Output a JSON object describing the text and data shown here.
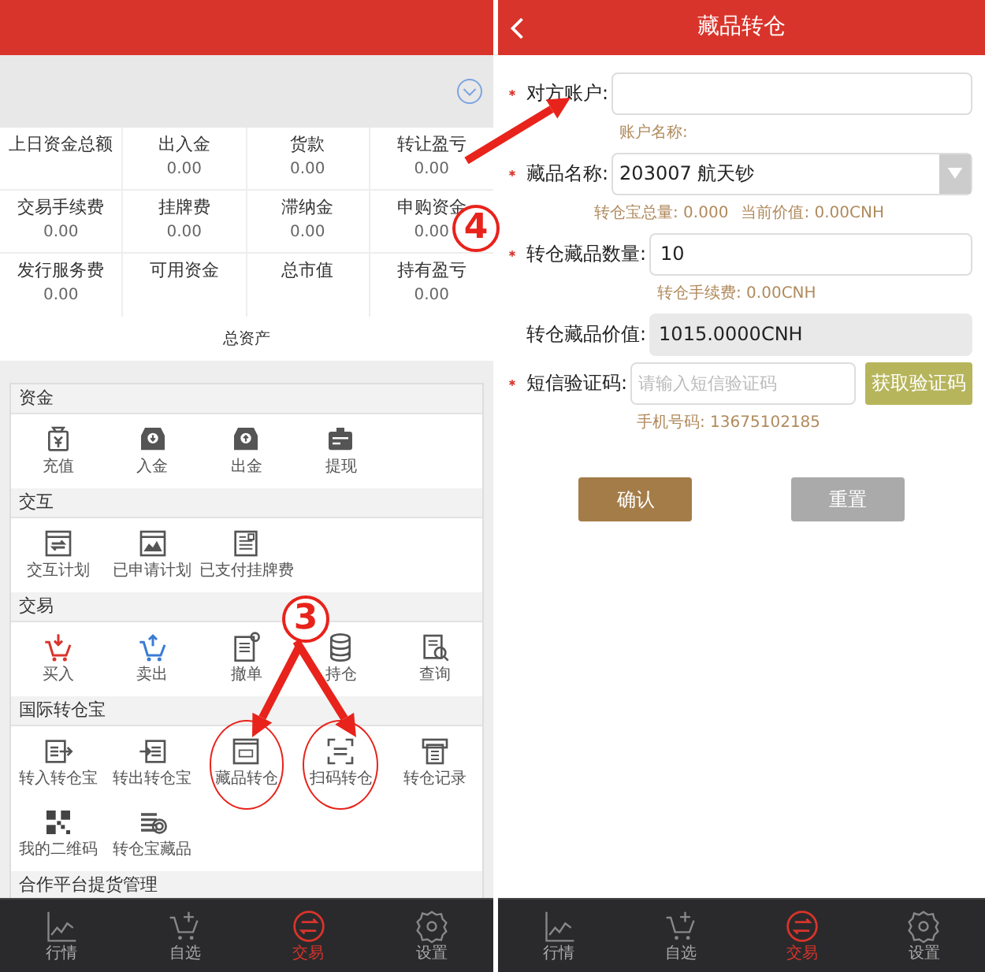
{
  "left_screen": {
    "summary": [
      {
        "label": "上日资金总额"
      },
      {
        "label": "出入金",
        "value": "0.00"
      },
      {
        "label": "货款",
        "value": "0.00"
      },
      {
        "label": "转让盈亏",
        "value": "0.00"
      },
      {
        "label": "交易手续费",
        "value": "0.00"
      },
      {
        "label": "挂牌费",
        "value": "0.00"
      },
      {
        "label": "滞纳金",
        "value": "0.00"
      },
      {
        "label": "申购资金",
        "value": "0.00"
      },
      {
        "label": "发行服务费",
        "value": "0.00"
      },
      {
        "label": "可用资金"
      },
      {
        "label": "总市值"
      },
      {
        "label": "持有盈亏",
        "value": "0.00"
      }
    ],
    "total_label": "总资产",
    "sections": [
      {
        "title": "资金",
        "items": [
          {
            "label": "充值",
            "circled": false
          },
          {
            "label": "入金",
            "circled": false
          },
          {
            "label": "出金",
            "circled": false
          },
          {
            "label": "提现",
            "circled": false
          }
        ]
      },
      {
        "title": "交互",
        "items": [
          {
            "label": "交互计划",
            "circled": false
          },
          {
            "label": "已申请计划",
            "circled": false
          },
          {
            "label": "已支付挂牌费",
            "circled": false
          }
        ]
      },
      {
        "title": "交易",
        "items": [
          {
            "label": "买入",
            "circled": false
          },
          {
            "label": "卖出",
            "circled": false
          },
          {
            "label": "撤单",
            "circled": false
          },
          {
            "label": "持仓",
            "circled": false
          },
          {
            "label": "查询",
            "circled": false
          }
        ]
      },
      {
        "title": "国际转仓宝",
        "items": [
          {
            "label": "转入转仓宝",
            "circled": false
          },
          {
            "label": "转出转仓宝",
            "circled": false
          },
          {
            "label": "藏品转仓",
            "circled": true
          },
          {
            "label": "扫码转仓",
            "circled": true
          },
          {
            "label": "转仓记录",
            "circled": false
          },
          {
            "label": "我的二维码",
            "circled": false
          },
          {
            "label": "转仓宝藏品",
            "circled": false
          }
        ]
      },
      {
        "title": "合作平台提货管理"
      }
    ],
    "tabs": [
      {
        "label": "行情",
        "selected": false
      },
      {
        "label": "自选",
        "selected": false
      },
      {
        "label": "交易",
        "selected": true
      },
      {
        "label": "设置",
        "selected": false
      }
    ]
  },
  "right_screen": {
    "title": "藏品转仓",
    "fields": [
      {
        "kind": "input",
        "required": true,
        "label": "对方账户:",
        "hints": [
          "账户名称:"
        ]
      },
      {
        "kind": "select",
        "required": true,
        "label": "藏品名称:",
        "value": "203007 航天钞",
        "hints": [
          "转仓宝总量: 0.000",
          "当前价值: 0.00CNH"
        ]
      },
      {
        "kind": "input",
        "required": true,
        "label": "转仓藏品数量:",
        "value": "10",
        "hints": [
          "转仓手续费: 0.00CNH"
        ]
      },
      {
        "kind": "readonly",
        "required": false,
        "label": "转仓藏品价值:",
        "value": "1015.0000CNH"
      },
      {
        "kind": "sms",
        "required": true,
        "label": "短信验证码:",
        "placeholder": "请输入短信验证码",
        "button": "获取验证码",
        "hints": [
          "手机号码: 13675102185"
        ]
      }
    ],
    "buttons": [
      {
        "kind": "primary",
        "label": "确认"
      },
      {
        "kind": "secondary",
        "label": "重置"
      }
    ],
    "tabs": [
      {
        "label": "行情",
        "selected": false
      },
      {
        "label": "自选",
        "selected": false
      },
      {
        "label": "交易",
        "selected": true
      },
      {
        "label": "设置",
        "selected": false
      }
    ]
  },
  "annotations": [
    {
      "number": "3"
    },
    {
      "number": "4"
    }
  ]
}
